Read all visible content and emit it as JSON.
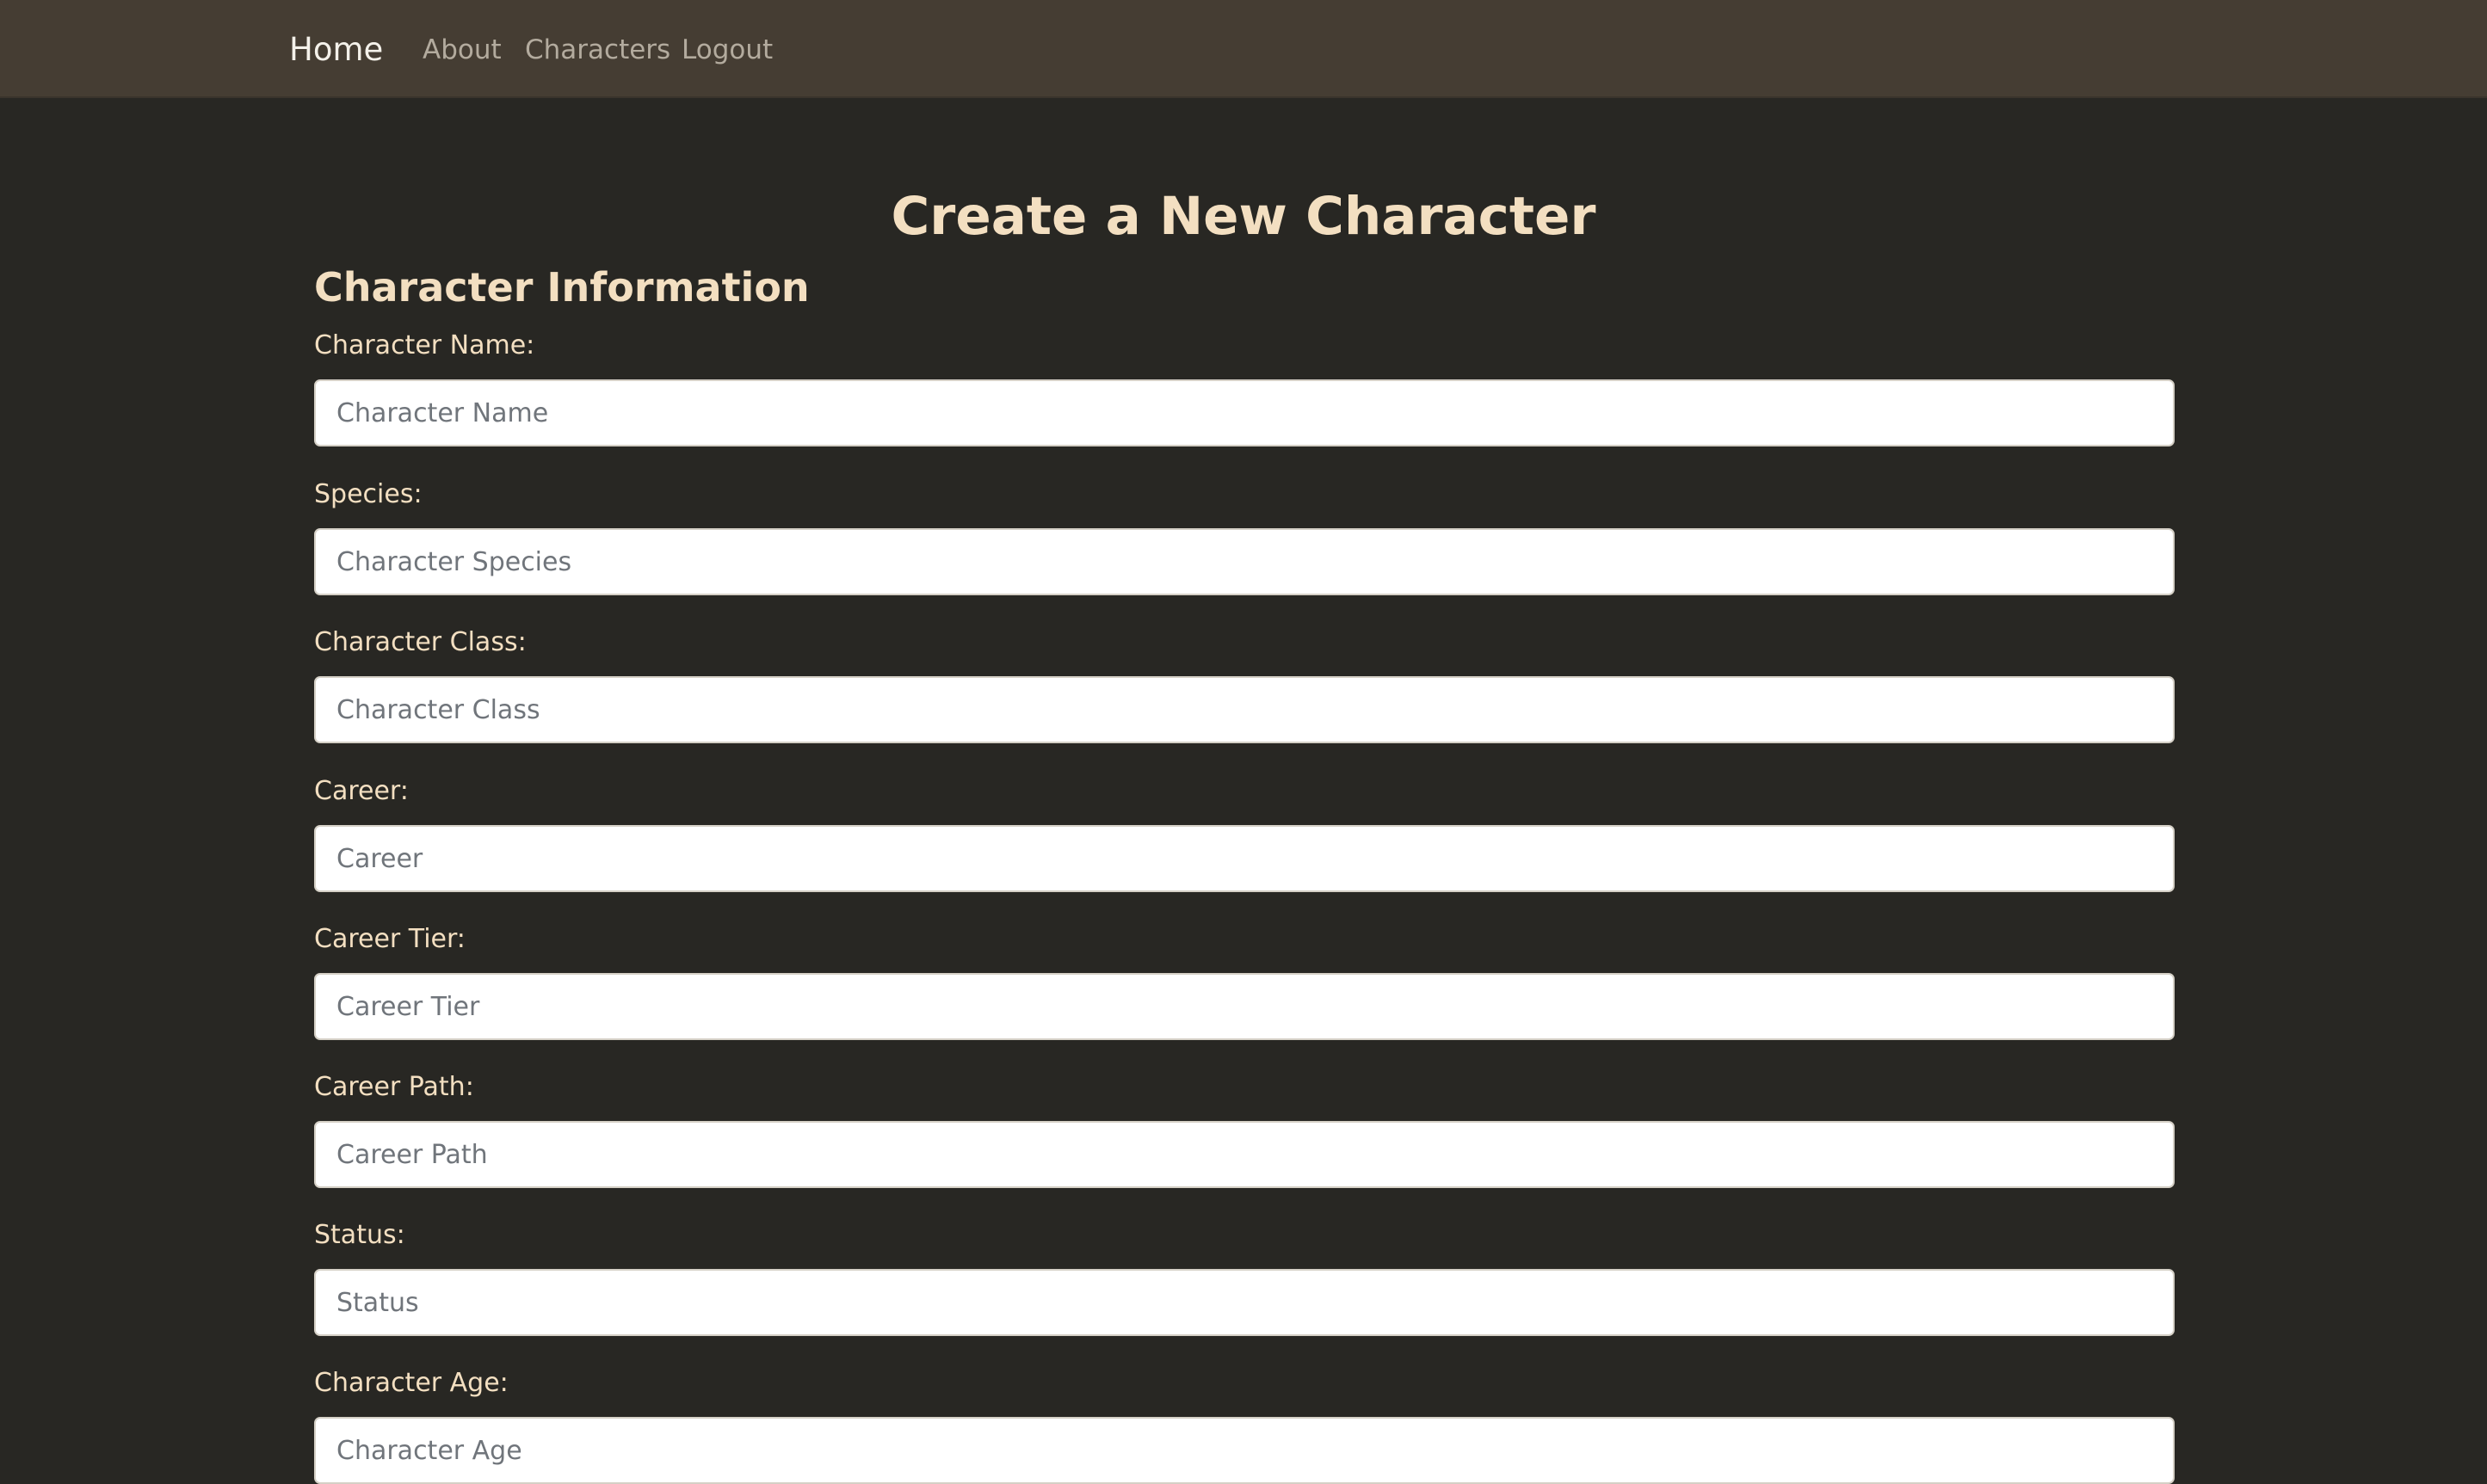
{
  "nav": {
    "brand": "Home",
    "links": [
      "About",
      "Characters",
      "Logout"
    ]
  },
  "page": {
    "title": "Create a New Character",
    "section_title": "Character Information"
  },
  "form": {
    "fields": [
      {
        "label": "Character Name:",
        "placeholder": "Character Name",
        "value": ""
      },
      {
        "label": "Species:",
        "placeholder": "Character Species",
        "value": ""
      },
      {
        "label": "Character Class:",
        "placeholder": "Character Class",
        "value": ""
      },
      {
        "label": "Career:",
        "placeholder": "Career",
        "value": ""
      },
      {
        "label": "Career Tier:",
        "placeholder": "Career Tier",
        "value": ""
      },
      {
        "label": "Career Path:",
        "placeholder": "Career Path",
        "value": ""
      },
      {
        "label": "Status:",
        "placeholder": "Status",
        "value": ""
      },
      {
        "label": "Character Age:",
        "placeholder": "Character Age",
        "value": ""
      }
    ]
  },
  "colors": {
    "background": "#282723",
    "navbar": "#453d33",
    "heading": "#f3dfc1",
    "nav_link": "#b3ab9e"
  }
}
